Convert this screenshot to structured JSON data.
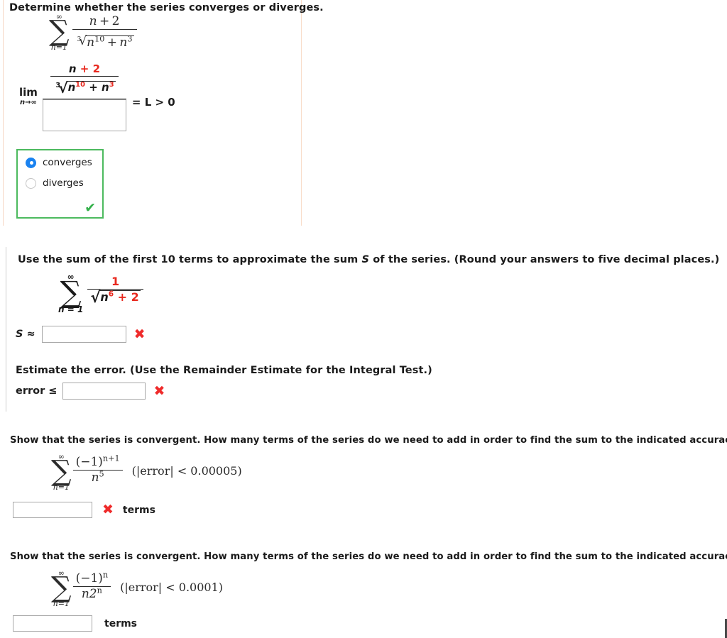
{
  "questions": [
    {
      "id": "q1",
      "prompt": "Determine whether the series converges or diverges.",
      "series": {
        "upper": "∞",
        "lower": "n=1",
        "numerator": "n + 2",
        "denominator_root_index": "3",
        "denominator_radicand": "n¹⁰ + n³"
      },
      "limit": {
        "operator": "lim",
        "subscript": "n→∞",
        "numerator_n": "n",
        "numerator_plus": "+",
        "numerator_two": "2",
        "root_index": "3",
        "radicand_n1": "n",
        "radicand_exp1": "10",
        "radicand_plus": "+",
        "radicand_n2": "n",
        "radicand_exp2": "3",
        "result": "= L > 0",
        "denominator_value": "",
        "denominator_placeholder": ""
      },
      "choices": [
        {
          "label": "converges",
          "selected": true
        },
        {
          "label": "diverges",
          "selected": false
        }
      ],
      "feedback": "correct",
      "feedback_glyph": "✔"
    },
    {
      "id": "q2",
      "prompt": "Use the sum of the first 10 terms to approximate the sum S of the series. (Round your answers to five decimal places.)",
      "prompt_parts": {
        "before": "Use the sum of the first 10 terms to approximate the sum ",
        "var": "S",
        "after": " of the series. (Round your answers to five decimal places.)"
      },
      "series": {
        "upper": "∞",
        "lower": "n = 1",
        "numerator": "1",
        "radicand_n": "n",
        "radicand_exp": "6",
        "radicand_plus": "+",
        "radicand_const": "2"
      },
      "answer": {
        "label_var": "S",
        "label_op": "≈",
        "value": "",
        "placeholder": ""
      },
      "feedback": "incorrect",
      "feedback_glyph": "✖"
    },
    {
      "id": "q3",
      "prompt": "Estimate the error. (Use the Remainder Estimate for the Integral Test.)",
      "answer": {
        "label": "error ≤",
        "value": "",
        "placeholder": ""
      },
      "feedback": "incorrect",
      "feedback_glyph": "✖"
    },
    {
      "id": "q4",
      "prompt": "Show that the series is convergent. How many terms of the series do we need to add in order to find the sum to the indicated accuracy?",
      "series": {
        "upper": "∞",
        "lower": "n=1",
        "numerator_base": "(−1)",
        "numerator_exp": "n+1",
        "denominator_base": "n",
        "denominator_exp": "5",
        "condition": "(|error| < 0.00005)"
      },
      "answer": {
        "value": "",
        "placeholder": "",
        "unit": "terms"
      },
      "feedback": "incorrect",
      "feedback_glyph": "✖"
    },
    {
      "id": "q5",
      "prompt": "Show that the series is convergent. How many terms of the series do we need to add in order to find the sum to the indicated accuracy?",
      "series": {
        "upper": "∞",
        "lower": "n=1",
        "numerator_base": "(−1)",
        "numerator_exp": "n",
        "denominator_base": "n2",
        "denominator_exp": "n",
        "condition": "(|error| < 0.0001)"
      },
      "answer": {
        "value": "",
        "placeholder": "",
        "unit": "terms"
      },
      "feedback": "none",
      "feedback_glyph": ""
    }
  ],
  "colors": {
    "correct_green": "#4cba5e",
    "incorrect_red": "#ef2b2b",
    "entered_red": "#e8281e",
    "radio_blue": "#1a82f0",
    "panel_border_peach": "#f6d6c4",
    "panel_border_gray": "#cfcfcf"
  }
}
